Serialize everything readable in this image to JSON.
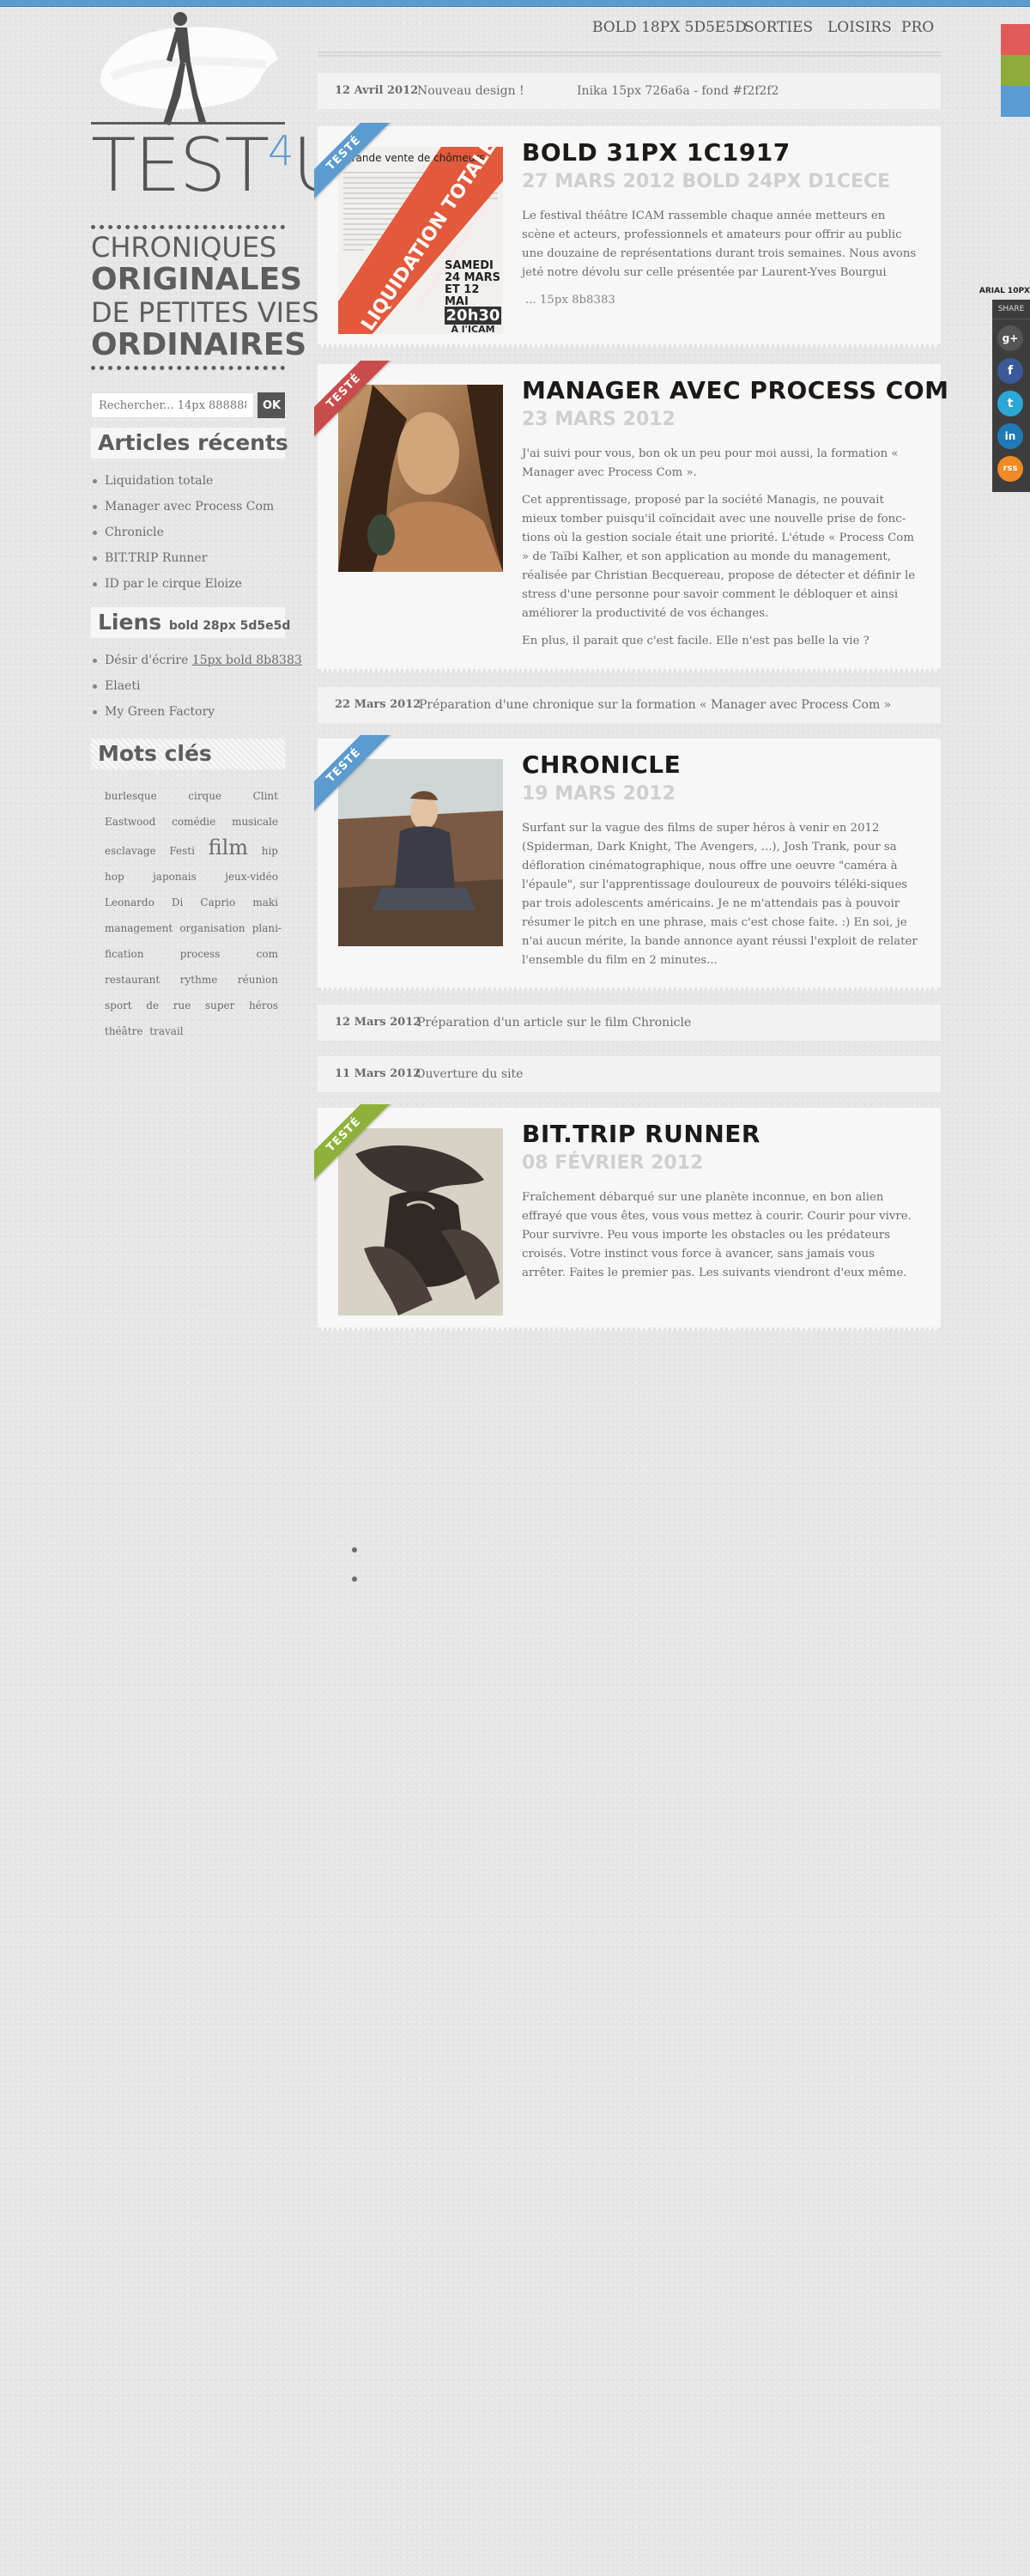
{
  "site": {
    "logo_text": "TEST",
    "logo_four": "4",
    "logo_u": "U",
    "tagline_1": "CHRONIQUES",
    "tagline_2": "ORIGINALES",
    "tagline_3": "DE PETITES VIES",
    "tagline_4": "ORDINAIRES"
  },
  "nav": [
    {
      "label": "BOLD 18PX 5D5E5D"
    },
    {
      "label": "SORTIES"
    },
    {
      "label": "LOISIRS"
    },
    {
      "label": "PRO"
    }
  ],
  "search": {
    "placeholder": "Rechercher... 14px 888888",
    "button": "OK"
  },
  "sidebar": {
    "recent_title": "Articles récents",
    "recent": [
      "Liquidation totale",
      "Manager avec Process Com",
      "Chronicle",
      "BIT.TRIP Runner",
      "ID par le cirque Eloize"
    ],
    "links_title": "Liens",
    "links_title_note": "bold 28px 5d5e5d",
    "links": [
      {
        "text": "Désir d'écrire",
        "note": "15px bold 8b8383"
      },
      {
        "text": "Elaeti",
        "note": ""
      },
      {
        "text": "My Green Factory",
        "note": ""
      }
    ],
    "tags_title": "Mots clés",
    "tags": [
      "burlesque",
      "cirque",
      "Clint",
      "Eastwood",
      "comédie",
      "musicale",
      "esclavage",
      "Festi",
      "film",
      "hip",
      "hop",
      "japonais",
      "jeux-vidéo",
      "Leonardo",
      "Di",
      "Caprio",
      "maki",
      "management",
      "organisation",
      "plani-fication",
      "process",
      "com",
      "restaurant",
      "rythme",
      "réunion",
      "sport",
      "de",
      "rue",
      "super",
      "héros",
      "théâtre",
      "travail"
    ]
  },
  "notices": [
    {
      "date": "12 Avril 2012",
      "text": "Nouveau design !",
      "extra": "Inika 15px 726a6a - fond #f2f2f2"
    },
    {
      "date": "22 Mars 2012",
      "text": "Préparation d'une chronique sur la formation « Manager avec Process Com »",
      "extra": ""
    },
    {
      "date": "12 Mars 2012",
      "text": "Préparation d'un article sur le film Chronicle",
      "extra": ""
    },
    {
      "date": "11 Mars 2012",
      "text": "Ouverture du site",
      "extra": ""
    }
  ],
  "posts": [
    {
      "ribbon": "TESTÉ",
      "title": "BOLD 31PX 1C1917",
      "date": "27 MARS 2012 BOLD 24PX D1CECE",
      "paragraphs": [
        "Le festival théâtre ICAM rassemble chaque année metteurs en scène et acteurs, professionnels et amateurs pour offrir au public une douzaine de représentations durant trois semaines. Nous avons jeté notre dévolu sur celle présentée par Laurent-Yves Bourgui"
      ],
      "more": "... 15px 8b8383",
      "thumb": {
        "header": "grande vente de chômeurs",
        "banner": "LIQUIDATION TOTALE",
        "banner_sub": "une pièce de Laurent-Yves Bourgui",
        "dates": "SAMEDI 24 MARS ET 12 MAI",
        "time": "20h30",
        "place": "À l'ICAM"
      }
    },
    {
      "ribbon": "TESTÉ",
      "title": "MANAGER AVEC PROCESS COM",
      "date": "23 MARS 2012",
      "paragraphs": [
        "J'ai suivi pour vous, bon ok un peu pour moi aussi, la formation « Manager avec Process Com ».",
        "Cet apprentissage, proposé par la société Managis, ne pouvait mieux tomber puisqu'il coïncidait avec une nouvelle prise de fonc-tions où la gestion sociale était une priorité. L'étude « Process Com » de Taïbi Kalher, et son application au monde du management, réalisée par Christian Becquereau, propose de détecter et définir le stress d'une personne pour savoir comment le débloquer et ainsi améliorer la productivité de vos échanges.",
        "En plus, il parait que c'est facile. Elle n'est pas belle la vie ?"
      ],
      "more": ""
    },
    {
      "ribbon": "TESTÉ",
      "title": "CHRONICLE",
      "date": "19 MARS 2012",
      "paragraphs": [
        "Surfant sur la vague des films de super héros à venir en 2012 (Spiderman, Dark Knight, The Avengers, ...), Josh Trank, pour sa défloration cinématographique, nous offre une oeuvre \"caméra à l'épaule\", sur l'apprentissage douloureux de pouvoirs téléki-siques par trois adolescents américains.  Je ne m'attendais pas à pouvoir résumer le pitch en une phrase, mais c'est chose faite. :) En soi, je n'ai aucun mérite,  la bande annonce ayant réussi l'exploit de relater l'ensemble du film en 2 minutes..."
      ],
      "more": ""
    },
    {
      "ribbon": "TESTÉ",
      "title": "BIT.TRIP RUNNER",
      "date": "08 FÉVRIER 2012",
      "paragraphs": [
        "Fraîchement débarqué sur une planète inconnue, en bon alien effrayé que vous êtes, vous vous mettez à courir. Courir pour vivre. Pour survivre. Peu vous importe les obstacles ou les prédateurs croisés. Votre instinct vous force à avancer, sans jamais vous arrêter. Faites le premier pas. Les suivants viendront d'eux même."
      ],
      "more": ""
    }
  ],
  "share": {
    "note": "ARIAL 10PX",
    "label": "SHARE",
    "buttons": [
      {
        "glyph": "g+"
      },
      {
        "glyph": "f"
      },
      {
        "glyph": "t"
      },
      {
        "glyph": "in"
      },
      {
        "glyph": "rss"
      }
    ]
  },
  "colors": {
    "accent": "#5b9bd0",
    "ribbon_blue": "#5b9bd0",
    "ribbon_red": "#c94c4c",
    "ribbon_green": "#8fb13b",
    "swatch_red": "#e05a5a",
    "swatch_green": "#8fab3e",
    "swatch_blue": "#5a9bd2"
  }
}
